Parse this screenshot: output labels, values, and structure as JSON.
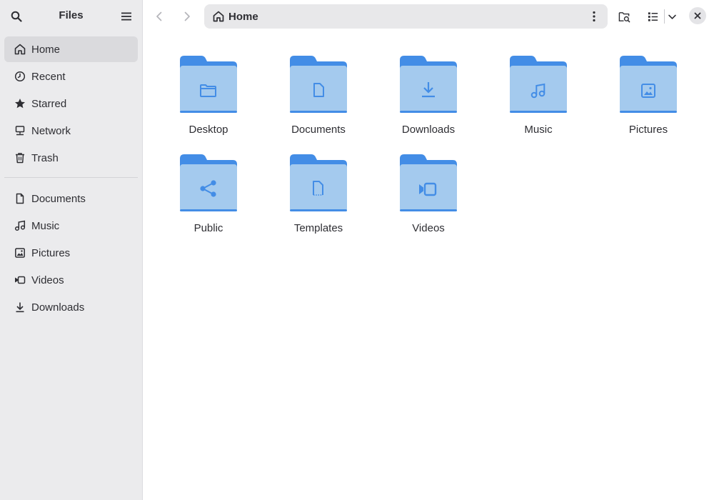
{
  "app": {
    "title": "Files"
  },
  "sidebar": {
    "places": [
      {
        "label": "Home",
        "icon": "home-icon",
        "active": true
      },
      {
        "label": "Recent",
        "icon": "clock-icon"
      },
      {
        "label": "Starred",
        "icon": "star-icon"
      },
      {
        "label": "Network",
        "icon": "network-icon"
      },
      {
        "label": "Trash",
        "icon": "trash-icon"
      }
    ],
    "bookmarks": [
      {
        "label": "Documents",
        "icon": "document-icon"
      },
      {
        "label": "Music",
        "icon": "music-icon"
      },
      {
        "label": "Pictures",
        "icon": "picture-icon"
      },
      {
        "label": "Videos",
        "icon": "video-icon"
      },
      {
        "label": "Downloads",
        "icon": "download-icon"
      }
    ]
  },
  "pathbar": {
    "location": "Home"
  },
  "folders": [
    {
      "label": "Desktop",
      "emblem": "folder-icon"
    },
    {
      "label": "Documents",
      "emblem": "document-icon"
    },
    {
      "label": "Downloads",
      "emblem": "download-icon"
    },
    {
      "label": "Music",
      "emblem": "music-icon"
    },
    {
      "label": "Pictures",
      "emblem": "picture-icon"
    },
    {
      "label": "Public",
      "emblem": "share-icon"
    },
    {
      "label": "Templates",
      "emblem": "template-icon"
    },
    {
      "label": "Videos",
      "emblem": "video-icon"
    }
  ],
  "colors": {
    "sidebar_bg": "#ebebed",
    "active_item": "#dadadd",
    "folder_back": "#438de6",
    "folder_front": "#a4caee",
    "emblem": "#438de6"
  }
}
